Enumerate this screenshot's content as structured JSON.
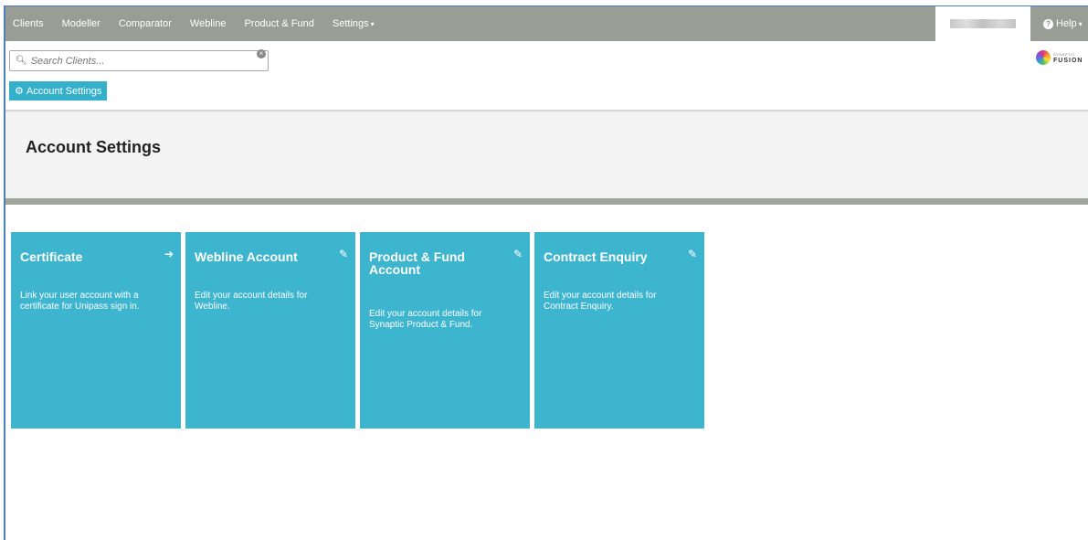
{
  "nav": {
    "items": [
      {
        "label": "Clients"
      },
      {
        "label": "Modeller"
      },
      {
        "label": "Comparator"
      },
      {
        "label": "Webline"
      },
      {
        "label": "Product & Fund"
      },
      {
        "label": "Settings"
      }
    ],
    "help_label": "Help"
  },
  "search": {
    "placeholder": "Search Clients..."
  },
  "toolbar": {
    "account_settings_label": "Account Settings"
  },
  "logo": {
    "small": "SYNAPTIC",
    "big": "FUSION"
  },
  "page": {
    "title": "Account Settings"
  },
  "tiles": [
    {
      "title": "Certificate",
      "description": "Link your user account with a certificate for Unipass sign in.",
      "icon": "arrow-right-icon"
    },
    {
      "title": "Webline Account",
      "description": "Edit your account details for Webline.",
      "icon": "pencil-icon"
    },
    {
      "title": "Product & Fund Account",
      "description": "Edit your account details for Synaptic Product & Fund.",
      "icon": "pencil-icon"
    },
    {
      "title": "Contract Enquiry",
      "description": "Edit your account details for Contract Enquiry.",
      "icon": "pencil-icon"
    }
  ],
  "colors": {
    "nav_bg": "#9a9d94",
    "accent": "#3db5cf",
    "button": "#35b0cb",
    "band": "#a3a69b"
  }
}
